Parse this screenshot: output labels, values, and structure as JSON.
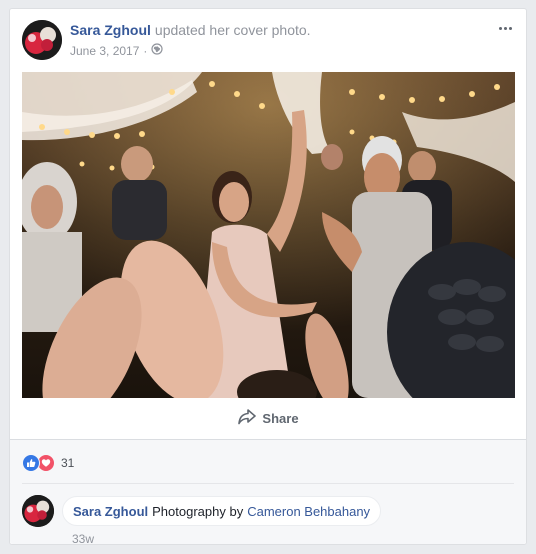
{
  "post": {
    "author_name": "Sara Zghoul",
    "action_text": "updated her cover photo.",
    "date": "June 3, 2017",
    "separator": "·",
    "privacy_icon": "globe-icon",
    "more_icon": "more-options-icon"
  },
  "photo": {
    "description_icon": "wedding-dance-photo"
  },
  "actions": {
    "share_label": "Share",
    "share_icon": "share-arrow-icon"
  },
  "reactions": {
    "types": [
      "like",
      "love"
    ],
    "count": "31",
    "like_color": "#3578e5",
    "love_color": "#f25268"
  },
  "comment": {
    "author_name": "Sara Zghoul",
    "text": "Photography by",
    "link_text": "Cameron Behbahany",
    "timestamp": "33w"
  },
  "colors": {
    "link": "#365899",
    "muted": "#90949c",
    "background": "#e9ebee"
  }
}
